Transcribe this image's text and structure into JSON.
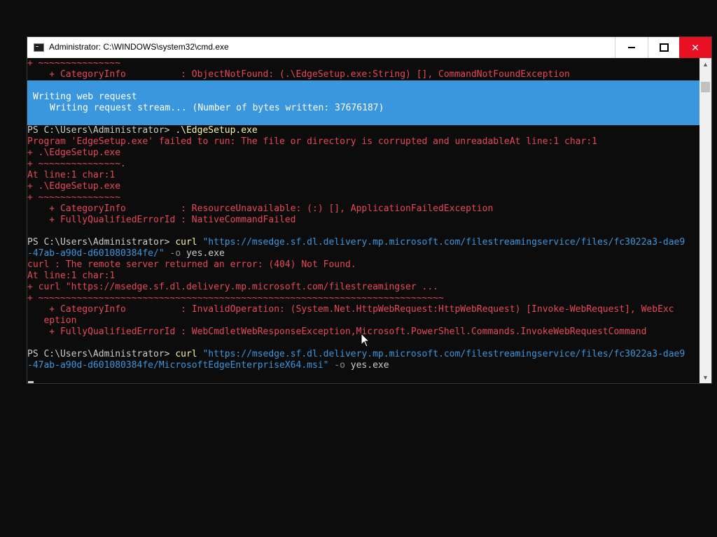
{
  "window": {
    "title": "Administrator: C:\\WINDOWS\\system32\\cmd.exe",
    "close_glyph": "✕"
  },
  "progress": {
    "activity": "Writing web request",
    "status": "Writing request stream... (Number of bytes written: 37676187)"
  },
  "console": {
    "top_lines": [
      "+ ~~~~~~~~~~~~~~~",
      "    + CategoryInfo          : ObjectNotFound: (.\\EdgeSetup.exe:String) [], CommandNotFoundException"
    ],
    "prompt": "PS C:\\Users\\Administrator> ",
    "cmd1": ".\\EdgeSetup.exe",
    "error_block_1": [
      "Program 'EdgeSetup.exe' failed to run: The file or directory is corrupted and unreadableAt line:1 char:1",
      "+ .\\EdgeSetup.exe",
      "+ ~~~~~~~~~~~~~~~.",
      "At line:1 char:1",
      "+ .\\EdgeSetup.exe",
      "+ ~~~~~~~~~~~~~~~",
      "    + CategoryInfo          : ResourceUnavailable: (:) [], ApplicationFailedException",
      "    + FullyQualifiedErrorId : NativeCommandFailed"
    ],
    "curl_cmd": "curl",
    "curl1_url_part1": "\"https://msedge.sf.dl.delivery.mp.microsoft.com/filestreamingservice/files/fc3022a3-dae9",
    "curl1_url_part2": "-47ab-a90d-d601080384fe/\"",
    "curl_param": "-o",
    "curl_out": "yes.exe",
    "error_block_2": [
      "curl : The remote server returned an error: (404) Not Found.",
      "At line:1 char:1",
      "+ curl \"https://msedge.sf.dl.delivery.mp.microsoft.com/filestreamingser ...",
      "+ ~~~~~~~~~~~~~~~~~~~~~~~~~~~~~~~~~~~~~~~~~~~~~~~~~~~~~~~~~~~~~~~~~~~~~~~~~~",
      "    + CategoryInfo          : InvalidOperation: (System.Net.HttpWebRequest:HttpWebRequest) [Invoke-WebRequest], WebExc",
      "   eption",
      "    + FullyQualifiedErrorId : WebCmdletWebResponseException,Microsoft.PowerShell.Commands.InvokeWebRequestCommand"
    ],
    "curl2_url_part1": "\"https://msedge.sf.dl.delivery.mp.microsoft.com/filestreamingservice/files/fc3022a3-dae9",
    "curl2_url_part2": "-47ab-a90d-d601080384fe/MicrosoftEdgeEnterpriseX64.msi\""
  },
  "colors": {
    "error": "#e74856",
    "progress_bg": "#3a96dd",
    "close_button": "#e81123"
  }
}
